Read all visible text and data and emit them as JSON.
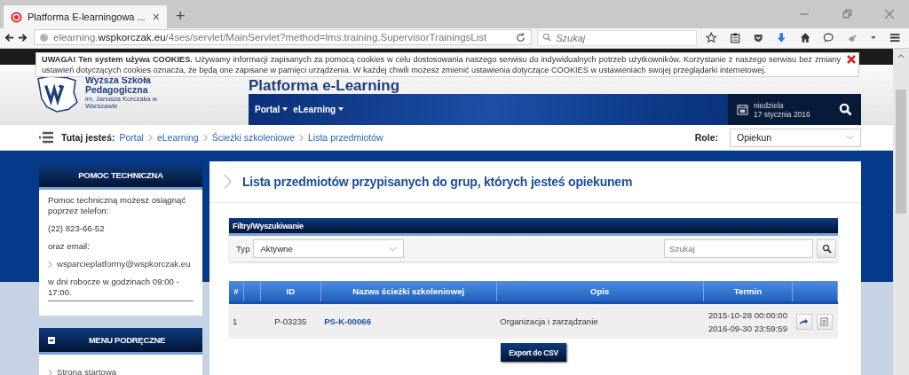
{
  "browser": {
    "tab_title": "Platforma E-learningowa ...",
    "tab_close": "×",
    "new_tab": "+",
    "url": {
      "host_prefix": "elearning.",
      "domain": "wspkorczak.eu",
      "path": "/4ses/servlet/MainServlet?method=lms.training.SupervisorTrainingsList"
    },
    "search_placeholder": "Szukaj"
  },
  "cookie_notice": {
    "text": "**UWAGA! Ten system używa COOKIES.** Używamy informacji zapisanych za pomocą cookies w celu dostosowania naszego serwisu do indywidualnych potrzeb użytkowników. Korzystanie z naszego serwisu bez zmiany ustawień dotyczących cookies oznacza, że będą one zapisane w pamięci urządzenia. W każdej chwili możesz zmienić ustawienia dotyczące COOKIES w ustawieniach swojej przeglądarki internetowej."
  },
  "header": {
    "school_name": "Wyższa Szkoła Pedagogiczna",
    "school_subtitle": "im. Janusza Korczaka w Warszawie",
    "platform_title": "Platforma e-Learning",
    "nav": [
      {
        "label": "Portal"
      },
      {
        "label": "eLearning"
      }
    ],
    "date_day": "niedziela",
    "date": "17 stycznia 2016"
  },
  "breadcrumb": {
    "label": "Tutaj jesteś:",
    "items": [
      "Portal",
      "eLearning",
      "Ścieżki szkoleniowe",
      "Lista przedmiotów"
    ]
  },
  "role": {
    "label": "Role:",
    "value": "Opiekun"
  },
  "sidebar": {
    "help": {
      "title": "POMOC TECHNICZNA",
      "intro": "Pomoc techniczną możesz osiągnąć poprzez telefon:",
      "phone": "(22) 823-66-52",
      "email_label": "oraz email:",
      "email": "wsparcieplatformy@wspkorczak.eu",
      "hours": "w dni robocze w godzinach 09:00 - 17:00."
    },
    "menu": {
      "title": "MENU PODRĘCZNE",
      "expanded": true,
      "items": [
        "Strona startowa"
      ]
    }
  },
  "main": {
    "title": "Lista przedmiotów przypisanych do grup, których jesteś opiekunem",
    "filters": {
      "title": "Filtry/Wyszukiwanie",
      "type_label": "Typ",
      "type_value": "Aktywne",
      "search_placeholder": "Szukaj"
    },
    "table": {
      "columns": [
        "#",
        "ID",
        "Nazwa ścieżki szkoleniowej",
        "Opis",
        "Termin"
      ],
      "rows": [
        {
          "number": "1",
          "id": "P-03235",
          "name": "PS-K-00066",
          "description": "Organizacja i zarządzanie",
          "start": "2015-10-28 00:00:00",
          "end": "2016-09-30 23:59:59"
        }
      ]
    },
    "export_button": "Export do CSV"
  }
}
